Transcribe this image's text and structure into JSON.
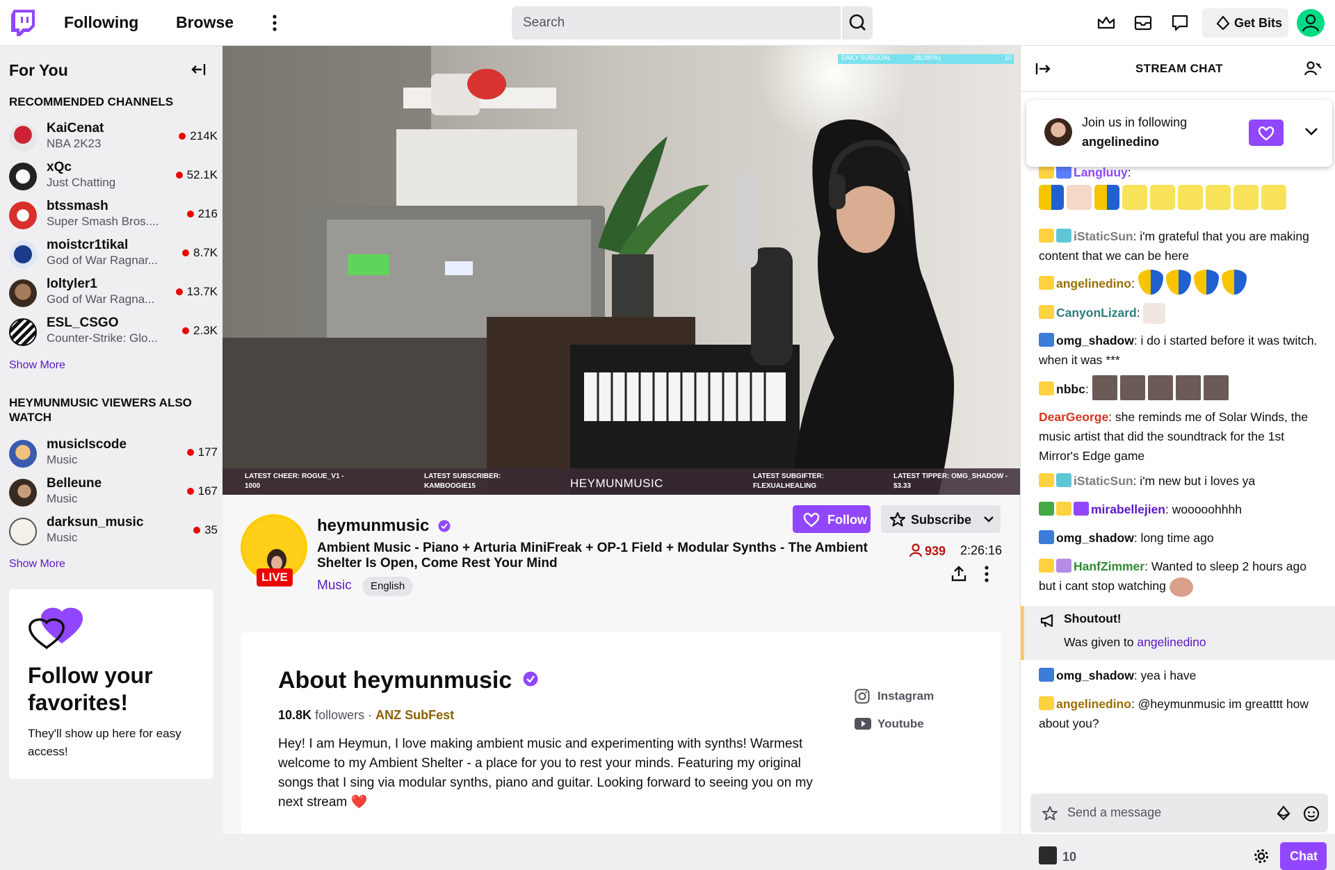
{
  "topbar": {
    "nav_following": "Following",
    "nav_browse": "Browse",
    "search_placeholder": "Search",
    "get_bits": "Get Bits"
  },
  "sidebar": {
    "title": "For You",
    "recommended_header": "RECOMMENDED CHANNELS",
    "recommended": [
      {
        "name": "KaiCenat",
        "game": "NBA 2K23",
        "viewers": "214K"
      },
      {
        "name": "xQc",
        "game": "Just Chatting",
        "viewers": "52.1K"
      },
      {
        "name": "btssmash",
        "game": "Super Smash Bros....",
        "viewers": "216"
      },
      {
        "name": "moistcr1tikal",
        "game": "God of War Ragnar...",
        "viewers": "8.7K"
      },
      {
        "name": "loltyler1",
        "game": "God of War Ragna...",
        "viewers": "13.7K"
      },
      {
        "name": "ESL_CSGO",
        "game": "Counter-Strike: Glo...",
        "viewers": "2.3K"
      }
    ],
    "show_more": "Show More",
    "also_watch_header": "HEYMUNMUSIC VIEWERS ALSO WATCH",
    "also_watch": [
      {
        "name": "musicIscode",
        "game": "Music",
        "viewers": "177"
      },
      {
        "name": "Belleune",
        "game": "Music",
        "viewers": "167"
      },
      {
        "name": "darksun_music",
        "game": "Music",
        "viewers": "35"
      }
    ],
    "promo_title": "Follow your favorites!",
    "promo_text": "They'll show up here for easy access!"
  },
  "video": {
    "overlay_goal": "DAILY SUBGOAL",
    "overlay_goal_value": "28(280%)",
    "overlay_goal_max": "10",
    "latest_cheer": "LATEST CHEER: ROGUE_V1 - 1000",
    "latest_subscriber": "LATEST SUBSCRIBER: KAMBOOGIE15",
    "channel_watermark": "HEYMUNMUSIC",
    "latest_subgifter": "LATEST SUBGIFTER: FLEXUALHEALING",
    "latest_tipper": "LATEST TIPPER: OMG_SHADOW - $3.33"
  },
  "stream": {
    "live": "LIVE",
    "name": "heymunmusic",
    "title": "Ambient Music - Piano + Arturia MiniFreak + OP-1 Field + Modular Synths - The Ambient Shelter Is Open, Come Rest Your Mind",
    "category": "Music",
    "tag": "English",
    "follow": "Follow",
    "subscribe": "Subscribe",
    "viewers": "939",
    "uptime": "2:26:16"
  },
  "about": {
    "title": "About heymunmusic",
    "followers_count": "10.8K",
    "followers_label": "followers",
    "team": "ANZ SubFest",
    "bio": "Hey! I am Heymun, I love making ambient music and experimenting with synths! Warmest welcome to my Ambient Shelter - a place for you to rest your minds. Featuring my original songs that I sing via modular synths, piano and guitar. Looking forward to seeing you on my next stream ❤️",
    "social_instagram": "Instagram",
    "social_youtube": "Youtube"
  },
  "chat": {
    "title": "STREAM CHAT",
    "pinned_line1": "Join us in following",
    "pinned_line2": "angelinedino",
    "messages": [
      {
        "user": "Langluuy",
        "text": ":",
        "color": "#9147ff"
      },
      {
        "user": "iStaticSun",
        "text": ": i'm grateful that you are making content that we can be here",
        "color": "#7d7d7d"
      },
      {
        "user": "angelinedino",
        "text": ":",
        "color": "#9b6f00"
      },
      {
        "user": "CanyonLizard",
        "text": ":",
        "color": "#2e7c7c"
      },
      {
        "user": "omg_shadow",
        "text": ": i do i started before it was twitch. when it was ***",
        "color": "#0e0e10"
      },
      {
        "user": "nbbc",
        "text": ":",
        "color": "#0e0e10"
      },
      {
        "user": "DearGeorge",
        "text": ": she reminds me of Solar Winds, the music artist that did the soundtrack for the 1st Mirror's Edge game",
        "color": "#d6341f"
      },
      {
        "user": "iStaticSun",
        "text": ": i'm new but i loves ya",
        "color": "#7d7d7d"
      },
      {
        "user": "mirabellejien",
        "text": ": wooooohhhh",
        "color": "#5c16c5"
      },
      {
        "user": "omg_shadow",
        "text": ": long time ago",
        "color": "#0e0e10"
      },
      {
        "user": "HanfZimmer",
        "text": ": Wanted to sleep 2 hours ago but i cant stop watching",
        "color": "#2f8a2f"
      },
      {
        "user": "omg_shadow",
        "text": ": yea i have",
        "color": "#0e0e10"
      },
      {
        "user": "angelinedino",
        "text": ": @heymunmusic im greatttt how about you?",
        "color": "#9b6f00"
      }
    ],
    "shoutout_title": "Shoutout!",
    "shoutout_prefix": "Was given to",
    "shoutout_user": "angelinedino",
    "input_placeholder": "Send a message",
    "points": "10",
    "chat_button": "Chat"
  },
  "colors": {
    "accent": "#9147ff",
    "live_red": "#eb0400",
    "link": "#5c16c5"
  }
}
